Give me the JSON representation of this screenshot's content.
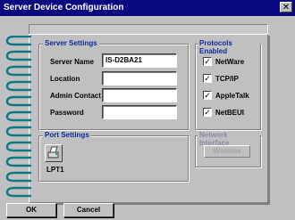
{
  "window": {
    "title": "Server Device Configuration",
    "close_label": "✕"
  },
  "server_settings": {
    "title": "Server Settings",
    "fields": [
      {
        "label": "Server Name",
        "value": "IS-D2BA21"
      },
      {
        "label": "Location",
        "value": ""
      },
      {
        "label": "Admin Contact",
        "value": ""
      },
      {
        "label": "Password",
        "value": ""
      }
    ]
  },
  "protocols": {
    "title": "Protocols Enabled",
    "items": [
      {
        "label": "NetWare",
        "checked": true
      },
      {
        "label": "TCP/IP",
        "checked": true
      },
      {
        "label": "AppleTalk",
        "checked": true
      },
      {
        "label": "NetBEUI",
        "checked": true
      }
    ]
  },
  "port_settings": {
    "title": "Port Settings",
    "port_label": "LPT1",
    "icon": "printer-icon"
  },
  "network_interface": {
    "title": "Network Interface",
    "wireless_label": "Wireless"
  },
  "buttons": {
    "ok": "OK",
    "cancel": "Cancel"
  },
  "colors": {
    "titlebar": "#0a0a80",
    "group_title": "#0b2b9b",
    "ring": "#0b7a86",
    "window": "#c0c0c0"
  }
}
